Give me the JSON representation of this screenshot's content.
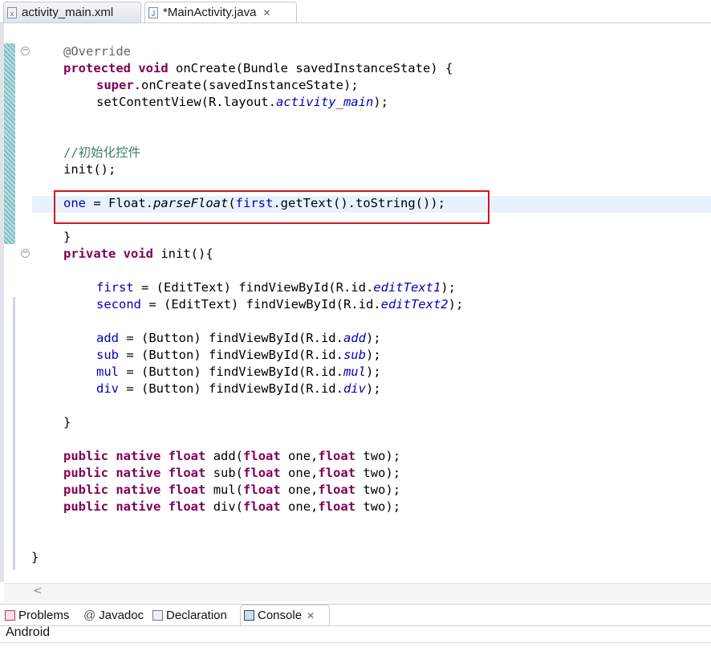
{
  "tabs": [
    {
      "label": "activity_main.xml"
    },
    {
      "label": "*MainActivity.java"
    }
  ],
  "code": {
    "annotation": "@Override",
    "oncreate_sig": [
      "protected",
      "void",
      " onCreate(Bundle savedInstanceState) {"
    ],
    "super_call": [
      "super",
      ".onCreate(savedInstanceState);"
    ],
    "setcontent": [
      "setContentView(R.layout.",
      "activity_main",
      ");"
    ],
    "comment": "//初始化控件",
    "init_call": "init();",
    "parse_line": [
      "one",
      " = Float.",
      "parseFloat",
      "(",
      "first",
      ".getText().toString());"
    ],
    "close_brace": "}",
    "init_sig": [
      "private",
      "void",
      " init(){"
    ],
    "first_line": [
      "first",
      " = (EditText) findViewById(R.id.",
      "editText1",
      ");"
    ],
    "second_line": [
      "second",
      " = (EditText) findViewById(R.id.",
      "editText2",
      ");"
    ],
    "buttons": [
      {
        "var": "add",
        "mid": " = (Button) findViewById(R.id.",
        "id": "add",
        "end": ");"
      },
      {
        "var": "sub",
        "mid": " = (Button) findViewById(R.id.",
        "id": "sub",
        "end": ");"
      },
      {
        "var": "mul",
        "mid": " = (Button) findViewById(R.id.",
        "id": "mul",
        "end": ");"
      },
      {
        "var": "div",
        "mid": " = (Button) findViewById(R.id.",
        "id": "div",
        "end": ");"
      }
    ],
    "natives": [
      {
        "name": " add(",
        "a": " one,",
        "b": " two);"
      },
      {
        "name": " sub(",
        "a": " one,",
        "b": " two);"
      },
      {
        "name": " mul(",
        "a": " one,",
        "b": " two);"
      },
      {
        "name": " div(",
        "a": " one,",
        "b": " two);"
      }
    ],
    "kw_public": "public",
    "kw_native": "native",
    "kw_float": "float",
    "class_close": "}"
  },
  "bottom_tabs": [
    {
      "label": "Problems"
    },
    {
      "label": "Javadoc"
    },
    {
      "label": "Declaration"
    },
    {
      "label": "Console"
    }
  ],
  "console_title": "Android",
  "scroll_left": "<"
}
